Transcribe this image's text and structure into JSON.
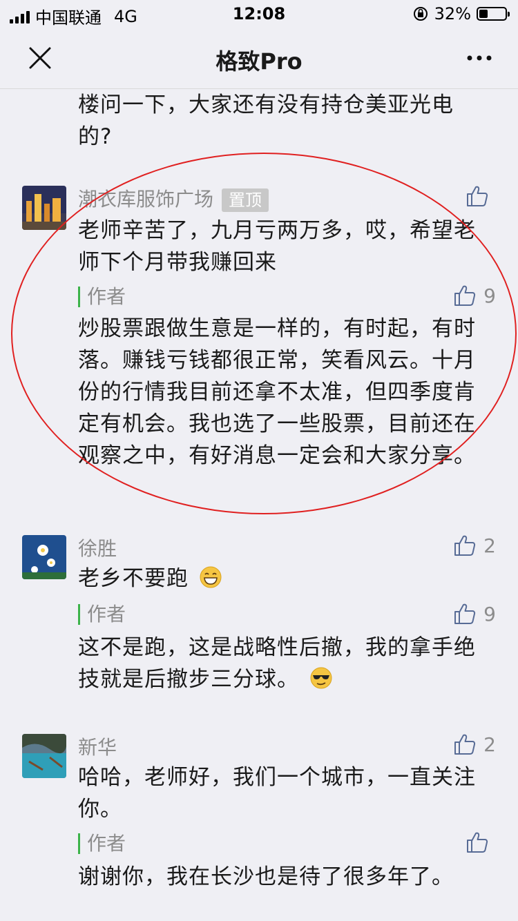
{
  "status": {
    "carrier": "中国联通",
    "network": "4G",
    "time": "12:08",
    "battery_pct": "32%",
    "battery_level": 0.32
  },
  "nav": {
    "title": "格致Pro",
    "close_icon": "close-icon",
    "more_icon": "more-icon"
  },
  "tail": {
    "text": "楼问一下，大家还有没有持仓美亚光电的?"
  },
  "comments": [
    {
      "nickname": "潮衣库服饰广场",
      "badge": "置顶",
      "likes": "",
      "text": "老师辛苦了，九月亏两万多，哎，希望老师下个月带我赚回来",
      "reply": {
        "tag": "作者",
        "likes": "9",
        "text": "炒股票跟做生意是一样的，有时起，有时落。赚钱亏钱都很正常，笑看风云。十月份的行情我目前还拿不太准，但四季度肯定有机会。我也选了一些股票，目前还在观察之中，有好消息一定会和大家分享。"
      }
    },
    {
      "nickname": "徐胜",
      "likes": "2",
      "text": "老乡不要跑",
      "reply": {
        "tag": "作者",
        "likes": "9",
        "text": "这不是跑，这是战略性后撤，我的拿手绝技就是后撤步三分球。"
      }
    },
    {
      "nickname": "新华",
      "likes": "2",
      "text": "哈哈，老师好，我们一个城市，一直关注你。",
      "reply": {
        "tag": "作者",
        "likes": "",
        "text": "谢谢你，我在长沙也是待了很多年了。"
      }
    }
  ],
  "colors": {
    "background": "#efeff4",
    "annotation": "#e02020",
    "author_bar": "#3cb34a"
  }
}
